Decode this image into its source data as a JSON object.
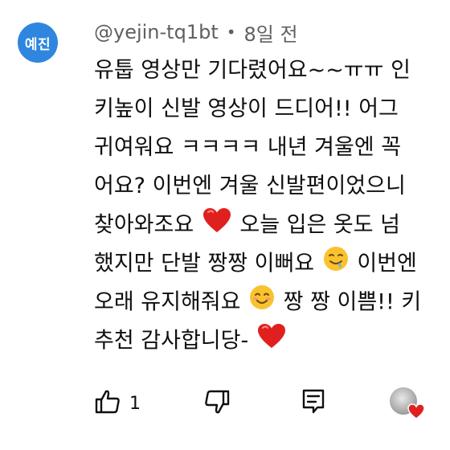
{
  "comment": {
    "avatar_text": "예진",
    "avatar_color": "#2e86de",
    "username": "@yejin-tq1bt",
    "separator": "•",
    "time": "8일 전",
    "lines": [
      {
        "parts": [
          "유툽 영상만 기다렸어요~~ㅠㅠ 인"
        ]
      },
      {
        "parts": [
          "키높이 신발 영상이 드디어!! 어그"
        ]
      },
      {
        "parts": [
          "귀여워요 ㅋㅋㅋㅋ 내년 겨울엔 꼭"
        ]
      },
      {
        "parts": [
          "어요? 이번엔 겨울 신발편이었으니"
        ]
      },
      {
        "parts": [
          "찾아와조요",
          "오늘 입은 옷도 넘"
        ],
        "emoji": "red-heart"
      },
      {
        "parts": [
          "했지만 단발 짱짱 이뻐요",
          "이번엔"
        ],
        "emoji": "drooling-face"
      },
      {
        "parts": [
          "오래 유지해줘요",
          "짱 짱 이쁨!! 키"
        ],
        "emoji": "smiling-face"
      },
      {
        "parts": [
          "추천 감사합니당-",
          ""
        ],
        "emoji": "red-heart"
      }
    ],
    "actions": {
      "like_icon": "thumbs-up-icon",
      "like_count": "1",
      "dislike_icon": "thumbs-down-icon",
      "reply_icon": "reply-icon",
      "creator_heart_icon": "creator-heart-icon"
    },
    "heart_color": "#e0201f"
  }
}
